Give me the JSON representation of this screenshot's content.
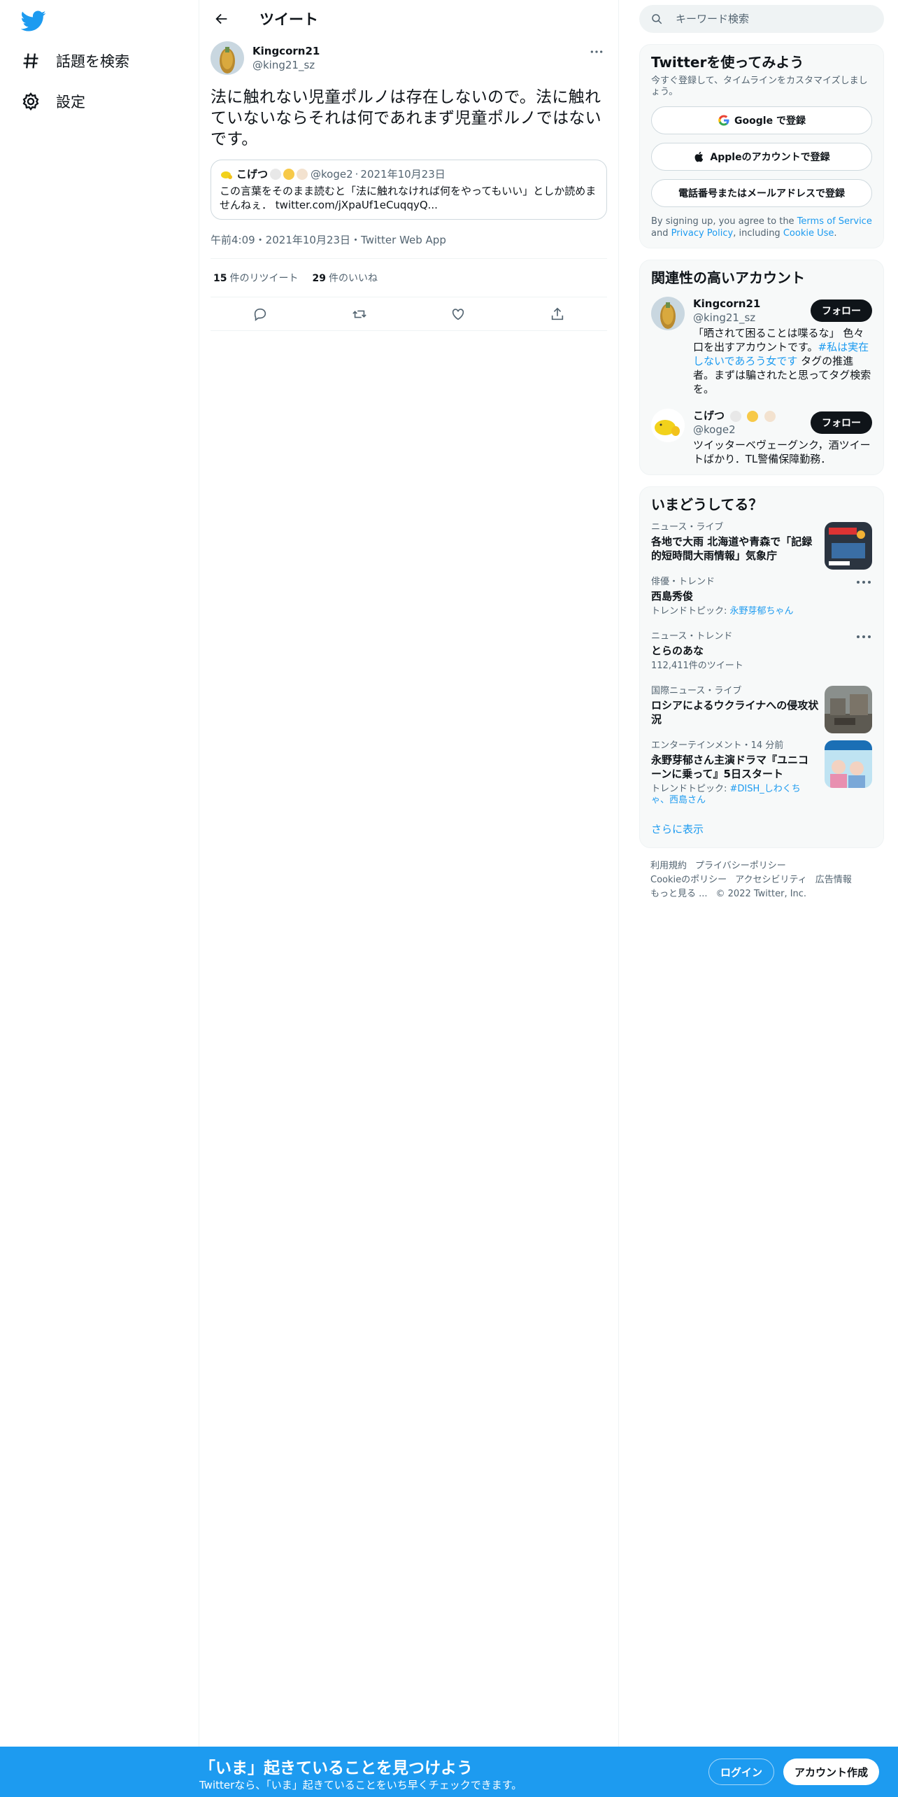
{
  "nav": {
    "explore_label": "話題を検索",
    "settings_label": "設定"
  },
  "header": {
    "title": "ツイート"
  },
  "tweet": {
    "author_name": "Kingcorn21",
    "author_handle": "@king21_sz",
    "text": "法に触れない児童ポルノは存在しないので。法に触れていないならそれは何であれまず児童ポルノではないです。",
    "quote": {
      "name": "こげつ",
      "handle": "@koge2",
      "date": "2021年10月23日",
      "text": "この言葉をそのまま読むと「法に触れなければ何をやってもいい」としか読めませんねぇ．",
      "link": "twitter.com/jXpaUf1eCuqqyQ..."
    },
    "timestamp": "午前4:09・2021年10月23日・Twitter Web App",
    "retweets_count": "15",
    "retweets_label": "件のリツイート",
    "likes_count": "29",
    "likes_label": "件のいいね"
  },
  "search": {
    "placeholder": "キーワード検索"
  },
  "signup": {
    "title": "Twitterを使ってみよう",
    "subtitle": "今すぐ登録して、タイムラインをカスタマイズしましょう。",
    "google_label": "Google で登録",
    "apple_label": "Appleのアカウントで登録",
    "phone_label": "電話番号またはメールアドレスで登録",
    "terms_prefix": "By signing up, you agree to the",
    "terms_link": "Terms of Service",
    "terms_and": "and",
    "privacy_link": "Privacy Policy",
    "terms_including": ", including",
    "cookie_link": "Cookie Use",
    "terms_end": "."
  },
  "related": {
    "title": "関連性の高いアカウント",
    "follow_label": "フォロー",
    "accounts": [
      {
        "name": "Kingcorn21",
        "handle": "@king21_sz",
        "bio_before": "「晒されて困ることは喋るな」 色々口を出すアカウントです。",
        "bio_link": "#私は実在しないであろう女です",
        "bio_after": " タグの推進者。まずは騙されたと思ってタグ検索を。"
      },
      {
        "name": "こげつ",
        "handle": "@koge2",
        "bio": "ツイッターベヴェーグンク，酒ツイートばかり．TL警備保障勤務．"
      }
    ]
  },
  "trends": {
    "title": "いまどうしてる？",
    "items": [
      {
        "category": "ニュース・ライブ",
        "title": "各地で大雨 北海道や青森で「記録的短時間大雨情報」気象庁"
      },
      {
        "category": "俳優・トレンド",
        "title": "西島秀俊",
        "sub_prefix": "トレンドトピック: ",
        "sub_link": "永野芽郁ちゃん"
      },
      {
        "category": "ニュース・トレンド",
        "title": "とらのあな",
        "sub": "112,411件のツイート"
      },
      {
        "category": "国際ニュース・ライブ",
        "title": "ロシアによるウクライナへの侵攻状況"
      },
      {
        "category": "エンターテインメント・14 分前",
        "title": "永野芽郁さん主演ドラマ『ユニコーンに乗って』5日スタート",
        "sub_prefix": "トレンドトピック: ",
        "sub_link": "#DISH_しわくちゃ、西島さん"
      }
    ],
    "show_more": "さらに表示"
  },
  "footer": {
    "terms": "利用規約",
    "privacy": "プライバシーポリシー",
    "cookie": "Cookieのポリシー",
    "accessibility": "アクセシビリティ",
    "ads": "広告情報",
    "more": "もっと見る ...",
    "copyright": "© 2022 Twitter, Inc."
  },
  "bottom_bar": {
    "title": "「いま」起きていることを見つけよう",
    "subtitle": "Twitterなら、「いま」起きていることをいち早くチェックできます。",
    "login_label": "ログイン",
    "signup_label": "アカウント作成"
  },
  "colors": {
    "brand": "#1d9bf0",
    "text": "#0f1419",
    "muted": "#536471"
  }
}
